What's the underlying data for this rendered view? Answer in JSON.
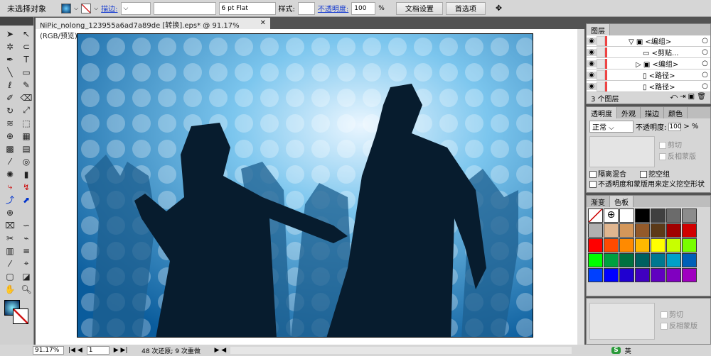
{
  "control_bar": {
    "selection": "未选择对象",
    "stroke_label": "描边:",
    "brush": "6 pt Flat",
    "style_label": "样式:",
    "opacity_label": "不透明度:",
    "opacity": "100",
    "percent": "%",
    "doc_setup": "文档设置",
    "preferences": "首选项"
  },
  "document": {
    "tab_title": "NiPic_nolong_123955a6ad7a89de  [转换].eps* @ 91.17% (RGB/预览)",
    "close": "✕"
  },
  "layers": {
    "title": "图层",
    "rows": [
      {
        "name": "<编组>"
      },
      {
        "name": "<剪贴..."
      },
      {
        "name": "<编组>"
      },
      {
        "name": "<路径>"
      },
      {
        "name": "<路径>"
      }
    ],
    "count": "3 个图层"
  },
  "transparency": {
    "tabs": [
      "透明度",
      "外观",
      "描边",
      "颜色"
    ],
    "mode": "正常",
    "opacity_label": "不透明度:",
    "opacity": "100",
    "clip": "剪切",
    "invert_mask": "反相蒙版",
    "isolate": "隔离混合",
    "knockout": "挖空组",
    "opacity_mask_shape": "不透明度和蒙版用来定义挖空形状"
  },
  "swatches": {
    "tabs": [
      "渐变",
      "色板"
    ],
    "colors": [
      "#ffffff",
      "#ffffff",
      "#ffffff",
      "#000000",
      "#404040",
      "#6b6b6b",
      "#8c8c8c",
      "#b0b0b0",
      "#e0b690",
      "#d4975a",
      "#935a2a",
      "#5c3a18",
      "#a00000",
      "#d10000",
      "#ff0000",
      "#ff4a00",
      "#ff8a00",
      "#ffb800",
      "#ffff00",
      "#c8ff00",
      "#78ff00",
      "#00ff00",
      "#00a040",
      "#007040",
      "#006060",
      "#007890",
      "#00a0c8",
      "#0060b8",
      "#0040ff",
      "#0000ff",
      "#2000d0",
      "#4000c0",
      "#6000c0",
      "#8000c0",
      "#a000c0"
    ]
  },
  "bottom_panel": {
    "clip": "剪切",
    "invert_mask": "反相蒙版"
  },
  "status": {
    "zoom": "91.17%",
    "page": "1",
    "info": "48 次还原; 9 次重做",
    "ime": "英"
  }
}
